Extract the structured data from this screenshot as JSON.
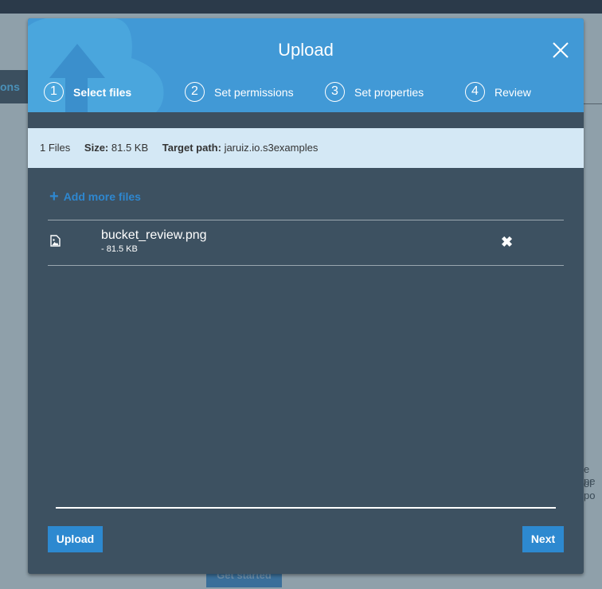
{
  "background": {
    "tab_label": "ons",
    "text_lines": [
      "e pe",
      "ol po"
    ],
    "get_started_label": "Get started"
  },
  "modal": {
    "title": "Upload",
    "steps": [
      {
        "number": "1",
        "label": "Select files",
        "active": true
      },
      {
        "number": "2",
        "label": "Set permissions",
        "active": false
      },
      {
        "number": "3",
        "label": "Set properties",
        "active": false
      },
      {
        "number": "4",
        "label": "Review",
        "active": false
      }
    ],
    "summary": {
      "files": "1 Files",
      "size_label": "Size:",
      "size_value": "81.5 KB",
      "target_label": "Target path:",
      "target_value": "jaruiz.io.s3examples"
    },
    "add_more_label": "Add more files",
    "files": [
      {
        "name": "bucket_review.png",
        "size": "- 81.5 KB",
        "icon": "image-file-icon"
      }
    ],
    "upload_label": "Upload",
    "next_label": "Next"
  },
  "colors": {
    "header": "#4199d6",
    "body": "#3d5161",
    "info": "#d4e8f5",
    "button": "#2d89d0"
  }
}
